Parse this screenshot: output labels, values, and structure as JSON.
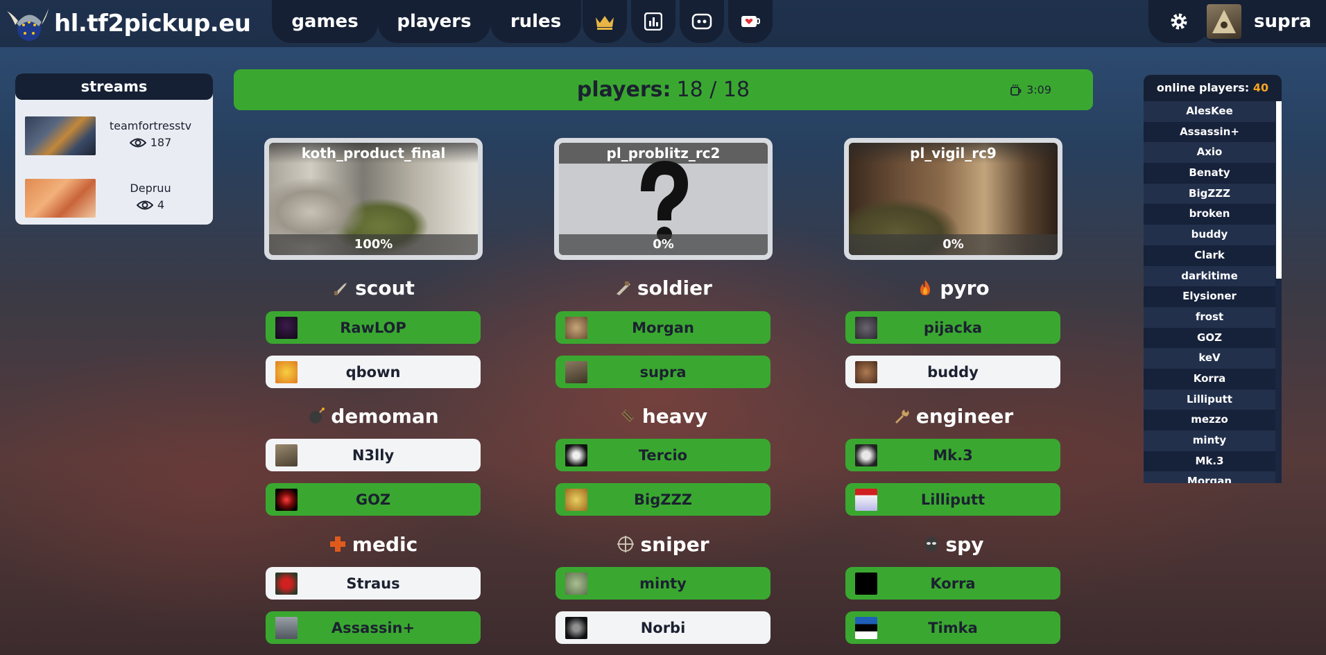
{
  "nav": {
    "brand": "hl.tf2pickup.eu",
    "links": [
      "games",
      "players",
      "rules"
    ],
    "user": "supra"
  },
  "streams": {
    "title": "streams",
    "items": [
      {
        "name": "teamfortresstv",
        "views": "187"
      },
      {
        "name": "Depruu",
        "views": "4"
      }
    ]
  },
  "status": {
    "label": "players:",
    "count": "18 / 18",
    "timer": "3:09"
  },
  "maps": [
    {
      "name": "koth_product_final",
      "percent": "100%"
    },
    {
      "name": "pl_problitz_rc2",
      "percent": "0%"
    },
    {
      "name": "pl_vigil_rc9",
      "percent": "0%"
    }
  ],
  "classes": [
    {
      "name": "scout",
      "players": [
        {
          "name": "RawLOP",
          "ready": true
        },
        {
          "name": "qbown",
          "ready": false
        }
      ]
    },
    {
      "name": "soldier",
      "players": [
        {
          "name": "Morgan",
          "ready": true
        },
        {
          "name": "supra",
          "ready": true
        }
      ]
    },
    {
      "name": "pyro",
      "players": [
        {
          "name": "pijacka",
          "ready": true
        },
        {
          "name": "buddy",
          "ready": false
        }
      ]
    },
    {
      "name": "demoman",
      "players": [
        {
          "name": "N3lly",
          "ready": false
        },
        {
          "name": "GOZ",
          "ready": true
        }
      ]
    },
    {
      "name": "heavy",
      "players": [
        {
          "name": "Tercio",
          "ready": true
        },
        {
          "name": "BigZZZ",
          "ready": true
        }
      ]
    },
    {
      "name": "engineer",
      "players": [
        {
          "name": "Mk.3",
          "ready": true
        },
        {
          "name": "Lilliputt",
          "ready": true
        }
      ]
    },
    {
      "name": "medic",
      "players": [
        {
          "name": "Straus",
          "ready": false
        },
        {
          "name": "Assassin+",
          "ready": true
        }
      ]
    },
    {
      "name": "sniper",
      "players": [
        {
          "name": "minty",
          "ready": true
        },
        {
          "name": "Norbi",
          "ready": false
        }
      ]
    },
    {
      "name": "spy",
      "players": [
        {
          "name": "Korra",
          "ready": true
        },
        {
          "name": "Timka",
          "ready": true
        }
      ]
    }
  ],
  "online": {
    "label": "online players:",
    "count": "40",
    "players": [
      "AlesKee",
      "Assassin+",
      "Axio",
      "Benaty",
      "BigZZZ",
      "broken",
      "buddy",
      "Clark",
      "darkitime",
      "Elysioner",
      "frost",
      "GOZ",
      "keV",
      "Korra",
      "Lilliputt",
      "mezzo",
      "minty",
      "Mk.3",
      "Morgan"
    ]
  },
  "colors": {
    "accent_green": "#3aa830",
    "nav_dark": "#152034",
    "count_orange": "#f5a623"
  }
}
